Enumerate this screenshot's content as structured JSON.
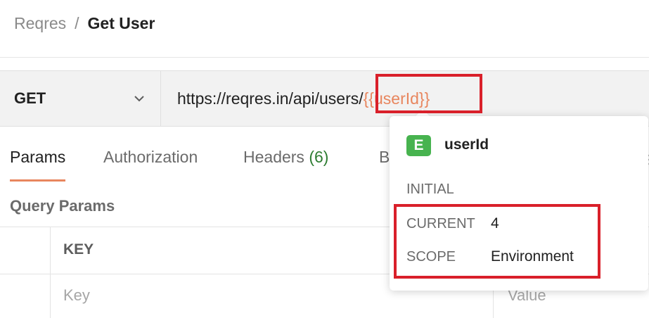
{
  "breadcrumb": {
    "parent": "Reqres",
    "separator": "/",
    "current": "Get User"
  },
  "request": {
    "method": "GET",
    "url_prefix": "https://reqres.in/api/users/",
    "url_variable": "{{userId}}"
  },
  "tabs": [
    {
      "label": "Params",
      "active": true
    },
    {
      "label": "Authorization"
    },
    {
      "label": "Headers",
      "count": "(6)"
    },
    {
      "label": "B"
    }
  ],
  "params": {
    "section_title": "Query Params",
    "key_header": "KEY",
    "key_placeholder": "Key",
    "value_placeholder": "Value"
  },
  "variable_popover": {
    "scope_badge": "E",
    "name": "userId",
    "initial_label": "INITIAL",
    "initial_value": "",
    "current_label": "CURRENT",
    "current_value": "4",
    "scope_label": "SCOPE",
    "scope_value": "Environment"
  },
  "colors": {
    "accent": "#e8865e",
    "highlight": "#d9202a",
    "env_badge": "#47b34f",
    "headers_count": "#2e7d32"
  },
  "icons": {
    "method_dropdown": "chevron-down-icon",
    "overflow": "more-vertical-icon"
  }
}
